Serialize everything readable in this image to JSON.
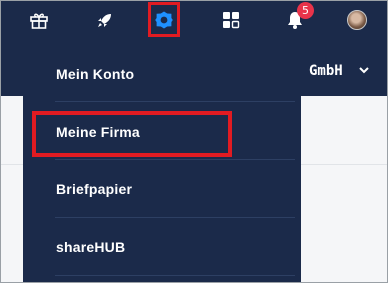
{
  "topbar": {
    "icons": [
      "gift-icon",
      "rocket-icon",
      "gear-icon",
      "apps-icon",
      "bell-icon",
      "avatar"
    ],
    "notification_count": "5"
  },
  "header": {
    "company_suffix": "GmbH"
  },
  "menu": {
    "items": [
      {
        "label": "Mein Konto"
      },
      {
        "label": "Meine Firma"
      },
      {
        "label": "Briefpapier"
      },
      {
        "label": "shareHUB"
      }
    ]
  },
  "colors": {
    "nav_background": "#1b2a4a",
    "highlight": "#e11b22",
    "gear_active": "#1e90ff",
    "badge": "#e8334a"
  }
}
